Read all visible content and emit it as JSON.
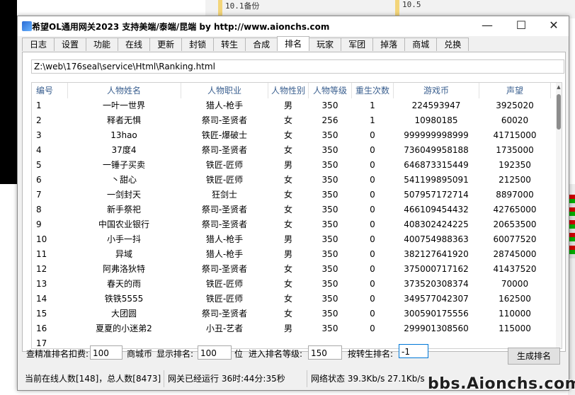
{
  "desktop": {
    "folders": [
      "10.1备份",
      "10.5"
    ]
  },
  "window": {
    "title": "希望OL通用网关2023 支持美端/泰端/昆端  by http://www.aionchs.com",
    "controls": {
      "minimize": "—",
      "maximize": "☐",
      "close": "✕"
    }
  },
  "tabs": [
    "日志",
    "设置",
    "功能",
    "在线",
    "更新",
    "封锁",
    "转生",
    "合成",
    "排名",
    "玩家",
    "军团",
    "掉落",
    "商城",
    "兑换"
  ],
  "active_tab": "排名",
  "ranking": {
    "path": "Z:\\web\\176seal\\service\\Html\\Ranking.html",
    "columns": [
      "编号",
      "人物姓名",
      "人物职业",
      "人物性别",
      "人物等级",
      "重生次数",
      "游戏币",
      "声望"
    ],
    "rows": [
      [
        "1",
        "一叶一世界",
        "猎人-枪手",
        "男",
        "350",
        "1",
        "224593947",
        "3925020"
      ],
      [
        "2",
        "释者无惧",
        "祭司-圣贤者",
        "女",
        "256",
        "1",
        "10980185",
        "60020"
      ],
      [
        "3",
        "13hao",
        "铁匠-爆破士",
        "女",
        "350",
        "0",
        "999999998999",
        "41715000"
      ],
      [
        "4",
        "37度4",
        "祭司-圣贤者",
        "女",
        "350",
        "0",
        "736049958188",
        "1735000"
      ],
      [
        "5",
        "一锤子买卖",
        "铁匠-匠师",
        "男",
        "350",
        "0",
        "646873315449",
        "192350"
      ],
      [
        "6",
        "丶甜心",
        "铁匠-匠师",
        "女",
        "350",
        "0",
        "541199895091",
        "212500"
      ],
      [
        "7",
        "一剑封天",
        "狂剑士",
        "女",
        "350",
        "0",
        "507957172714",
        "8897000"
      ],
      [
        "8",
        "新手祭祀",
        "祭司-圣贤者",
        "女",
        "350",
        "0",
        "466109454432",
        "42765000"
      ],
      [
        "9",
        "中国农业银行",
        "祭司-圣贤者",
        "女",
        "350",
        "0",
        "408302424225",
        "20653500"
      ],
      [
        "10",
        "小手一抖",
        "猎人-枪手",
        "男",
        "350",
        "0",
        "400754988363",
        "60077520"
      ],
      [
        "11",
        "异域",
        "猎人-枪手",
        "男",
        "350",
        "0",
        "382127641920",
        "28745000"
      ],
      [
        "12",
        "阿弗洛狄特",
        "祭司-圣贤者",
        "女",
        "350",
        "0",
        "375000717162",
        "41437520"
      ],
      [
        "13",
        "春天的雨",
        "铁匠-匠师",
        "女",
        "350",
        "0",
        "373520308374",
        "70000"
      ],
      [
        "14",
        "铁铁5555",
        "铁匠-匠师",
        "女",
        "350",
        "0",
        "349577042307",
        "162500"
      ],
      [
        "15",
        "大团圆",
        "祭司-圣贤者",
        "女",
        "350",
        "0",
        "300590175556",
        "110000"
      ],
      [
        "16",
        "夏夏的小迷弟2",
        "小丑-艺者",
        "男",
        "350",
        "0",
        "299901308560",
        "115000"
      ],
      [
        "17",
        "",
        "",
        "",
        "",
        "",
        "",
        ""
      ]
    ]
  },
  "options": {
    "deduct_label": "查精准排名扣费:",
    "deduct_value": "100",
    "currency_label": "商城币",
    "show_label": "显示排名:",
    "show_value": "100",
    "show_unit": "位",
    "level_label": "进入排名等级:",
    "level_value": "150",
    "rebirth_label": "按转生排名:",
    "rebirth_value": "-1",
    "generate_button": "生成排名"
  },
  "status": {
    "online": "当前在线人数[148]，总人数[8473]",
    "uptime": "网关已经运行 36时:44分:35秒",
    "network": "网络状态  39.3Kb/s    27.1Kb/s"
  },
  "watermark": "bbs.Aionchs.com"
}
